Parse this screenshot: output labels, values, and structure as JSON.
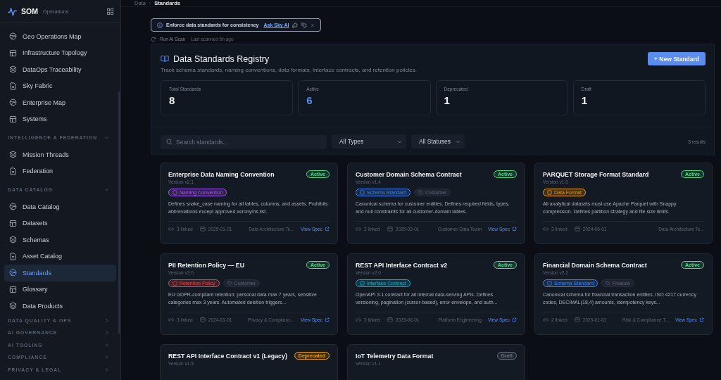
{
  "sidebar": {
    "brand": "SOM",
    "brand_sub": "Operations",
    "groups": [
      {
        "items": [
          {
            "label": "Geo Operations Map",
            "selected": false
          },
          {
            "label": "Infrastructure Topology",
            "selected": false
          },
          {
            "label": "DataOps Traceability",
            "selected": false
          },
          {
            "label": "Sky Fabric",
            "selected": false
          },
          {
            "label": "Enterprise Map",
            "selected": false
          },
          {
            "label": "Systems",
            "selected": false
          }
        ]
      },
      {
        "title": "INTELLIGENCE & FEDERATION",
        "expanded": true,
        "items": [
          {
            "label": "Mission Threads",
            "selected": false
          },
          {
            "label": "Federation",
            "selected": false
          }
        ]
      },
      {
        "title": "DATA CATALOG",
        "expanded": true,
        "items": [
          {
            "label": "Data Catalog",
            "selected": false
          },
          {
            "label": "Datasets",
            "selected": false
          },
          {
            "label": "Schemas",
            "selected": false
          },
          {
            "label": "Asset Catalog",
            "selected": false
          },
          {
            "label": "Standards",
            "selected": true
          },
          {
            "label": "Glossary",
            "selected": false
          },
          {
            "label": "Data Products",
            "selected": false
          }
        ]
      },
      {
        "title": "DATA QUALITY & OPS",
        "expanded": false
      },
      {
        "title": "AI GOVERNANCE",
        "expanded": false
      },
      {
        "title": "AI TOOLING",
        "expanded": false
      },
      {
        "title": "COMPLIANCE",
        "expanded": false
      },
      {
        "title": "PRIVACY & LEGAL",
        "expanded": false
      }
    ]
  },
  "breadcrumb": {
    "items": [
      "Data",
      "Standards"
    ],
    "separator": "›"
  },
  "ai_banner": {
    "text": "Enforce data standards for consistency",
    "link": "Ask Sky AI"
  },
  "scan": {
    "action": "Run AI Scan",
    "last": "Last scanned 6h ago"
  },
  "header": {
    "title": "Data Standards Registry",
    "subtitle": "Track schema standards, naming conventions, data formats, interface contracts, and retention policies.",
    "button": "+ New Standard"
  },
  "stats": [
    {
      "label": "Total Standards",
      "value": "8",
      "kind": "plain"
    },
    {
      "label": "Active",
      "value": "6",
      "kind": "accent"
    },
    {
      "label": "Deprecated",
      "value": "1",
      "kind": "plain"
    },
    {
      "label": "Draft",
      "value": "1",
      "kind": "plain"
    }
  ],
  "filters": {
    "search_placeholder": "Search standards...",
    "type": "All Types",
    "status": "All Statuses",
    "results": "8 results"
  },
  "cards": [
    {
      "title": "Enterprise Data Naming Convention",
      "version": "Version v2.1",
      "status": {
        "label": "Active",
        "color": "#4ade80"
      },
      "tags": [
        {
          "label": "Naming Convention",
          "kind": "type",
          "color": "#a855f7"
        }
      ],
      "description": "Defines snake_case naming for all tables, columns, and assets. Prohibits abbreviations except approved acronyms list.",
      "linked": "3 linked",
      "date": "2025-01-01",
      "owner": "Data Architecture Te...",
      "link": "View Spec"
    },
    {
      "title": "Customer Domain Schema Contract",
      "version": "Version v1.4",
      "status": {
        "label": "Active",
        "color": "#4ade80"
      },
      "tags": [
        {
          "label": "Schema Standard",
          "kind": "type",
          "color": "#3b82f6"
        },
        {
          "label": "Customer",
          "kind": "domain"
        }
      ],
      "description": "Canonical schema for customer entities. Defines required fields, types, and null constraints for all customer-domain tables.",
      "linked": "2 linked",
      "date": "2025-03-01",
      "owner": "Customer Data Team",
      "link": "View Spec"
    },
    {
      "title": "PARQUET Storage Format Standard",
      "version": "Version v1.0",
      "status": {
        "label": "Active",
        "color": "#4ade80"
      },
      "tags": [
        {
          "label": "Data Format",
          "kind": "type",
          "color": "#f59e0b"
        }
      ],
      "description": "All analytical datasets must use Apache Parquet with Snappy compression. Defines partition strategy and file size limits.",
      "linked": "3 linked",
      "date": "2024-06-01",
      "owner": "Data Architecture Te..."
    },
    {
      "title": "PII Retention Policy — EU",
      "version": "Version v3.0",
      "status": {
        "label": "Active",
        "color": "#4ade80"
      },
      "tags": [
        {
          "label": "Retention Policy",
          "kind": "type",
          "color": "#ef4444"
        },
        {
          "label": "Customer",
          "kind": "domain"
        }
      ],
      "description": "EU GDPR-compliant retention: personal data max 7 years, sensitive categories max 3 years. Automated deletion triggers...",
      "linked": "3 linked",
      "date": "2024-01-01",
      "owner": "Privacy & Complianc...",
      "link": "View Spec"
    },
    {
      "title": "REST API Interface Contract v2",
      "version": "Version v2.0",
      "status": {
        "label": "Active",
        "color": "#4ade80"
      },
      "tags": [
        {
          "label": "Interface Contract",
          "kind": "type",
          "color": "#06b6d4"
        }
      ],
      "description": "OpenAPI 3.1 contract for all internal data-serving APIs. Defines versioning, pagination (cursor-based), error envelope, and auth...",
      "linked": "2 linked",
      "date": "2025-06-01",
      "owner": "Platform Engineering",
      "link": "View Spec"
    },
    {
      "title": "Financial Domain Schema Contract",
      "version": "Version v2.2",
      "status": {
        "label": "Active",
        "color": "#4ade80"
      },
      "tags": [
        {
          "label": "Schema Standard",
          "kind": "type",
          "color": "#3b82f6"
        },
        {
          "label": "Finance",
          "kind": "domain"
        }
      ],
      "description": "Canonical schema for financial transaction entities. ISO 4217 currency codes, DECIMAL(18,4) amounts, idempotency keys...",
      "linked": "2 linked",
      "date": "2025-01-01",
      "owner": "Risk & Compliance T...",
      "link": "View Spec"
    },
    {
      "title": "REST API Interface Contract v1 (Legacy)",
      "version": "Version v1.5",
      "status": {
        "label": "Deprecated",
        "color": "#f59e0b"
      }
    },
    {
      "title": "IoT Telemetry Data Format",
      "version": "Version v1.1",
      "status": {
        "label": "Draft",
        "color": "#6b7280"
      }
    }
  ]
}
